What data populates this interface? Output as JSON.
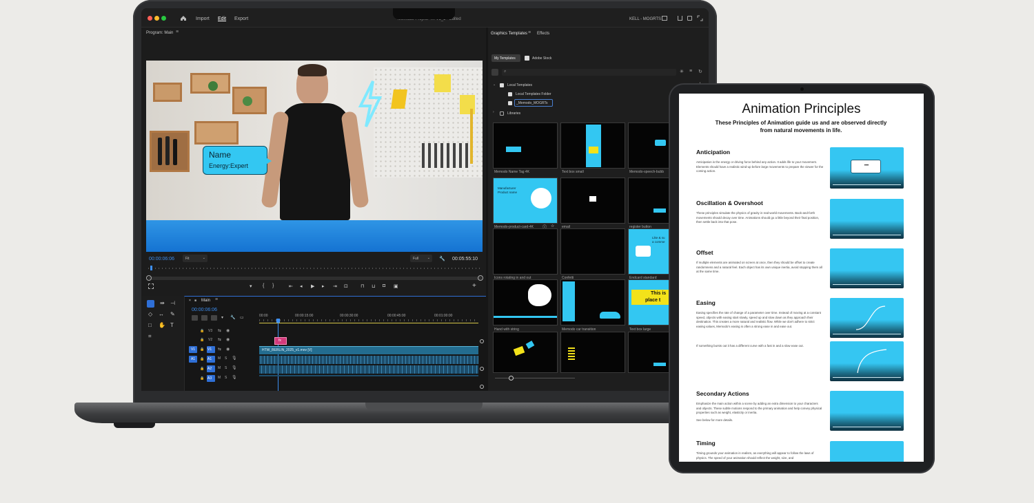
{
  "premiere": {
    "menu": [
      "Import",
      "Edit",
      "Export"
    ],
    "project_title": "Memodo-Project-4K-V1_1 - Edited",
    "workspace": "KELL - MOGRTS",
    "program_label": "Program: Main",
    "timecode_in": "00:00:06:06",
    "fit_label": "Fit",
    "full_label": "Full",
    "timecode_out": "00:05:55:10",
    "lower_third": {
      "name": "Name",
      "role": "Energy:Expert"
    },
    "timeline": {
      "sequence": "Main",
      "timecode": "00:00:06:06",
      "ruler": [
        "00:00",
        "00:00:15:00",
        "00:00:30:00",
        "00:00:45:00",
        "00:01:00:00"
      ],
      "tracks": [
        "V3",
        "V2",
        "V1",
        "A1",
        "A2",
        "A3"
      ],
      "clip_name": "HTW_BERLIN_2025_v1.mov [V]",
      "marker": "fx"
    },
    "gt": {
      "tabs": [
        "Graphics Templates",
        "Effects"
      ],
      "subtabs": [
        "My Templates",
        "Adobe Stock"
      ],
      "tree": [
        "Local Templates",
        "Local Templates Folder",
        "_Memodo_MOGRTs",
        "Libraries"
      ],
      "thumbs": [
        "Memodo Name Tag 4K",
        "Text box small",
        "Memodo-speech-bubb",
        "Memodo-product-card-4K",
        "email",
        "register button",
        "Icons rotating in and out",
        "Confetti",
        "Endcard standard",
        "Hand with string",
        "Memodo car transition",
        "Text box large",
        "",
        "",
        ""
      ],
      "product_card": [
        "Manufacturer",
        "Product name"
      ],
      "endcard_text": [
        "Like & su",
        "a comme"
      ],
      "textbox_large": [
        "This is",
        "place t"
      ]
    }
  },
  "tablet": {
    "title": "Animation Principles",
    "subtitle": "These Principles of Animation guide us and are observed directly from natural movements in life.",
    "sections": [
      {
        "title": "Anticipation",
        "body": "Anticipation is the energy or driving force behind any action. It adds life to your movement. Elements should have a realistic wind-up before large movements to prepare the viewer for the coming action."
      },
      {
        "title": "Oscillation & Overshoot",
        "body": "These principles simulate the physics of gravity in real-world movements. Back-and-forth movements should decay over time. Animations should go a little beyond their final position, then settle back into that pose."
      },
      {
        "title": "Offset",
        "body": "If multiple elements are animated on screen at once, then they should be offset to create randomness and a natural feel. Each object has its own unique inertia, avoid stopping them all at the same time."
      },
      {
        "title": "Easing",
        "body": "Easing specifies the rate of change of a parameter over time. Instead of moving at a constant speed, objects with easing start slowly, speed up and slow down as they approach their destination. This creates a more natural and realistic flow. While we don't adhere to strict easing values, Memodo's easing is often a strong ease in and ease out.",
        "extra": "If something bursts out it has a different curve with a fast in and a slow ease out."
      },
      {
        "title": "Secondary Actions",
        "body": "Emphasize the main action within a scene by adding an extra dimension to your characters and objects. These subtle motions respond to the primary animation and help convey physical properties such as weight, elasticity or inertia.",
        "extra": "See below for more details."
      },
      {
        "title": "Timing",
        "body": "Timing grounds your animation in realism, as everything will appear to follow the laws of physics. The speed of your animation should reflect the weight, size, and"
      }
    ],
    "bubble_dots": "•••"
  }
}
